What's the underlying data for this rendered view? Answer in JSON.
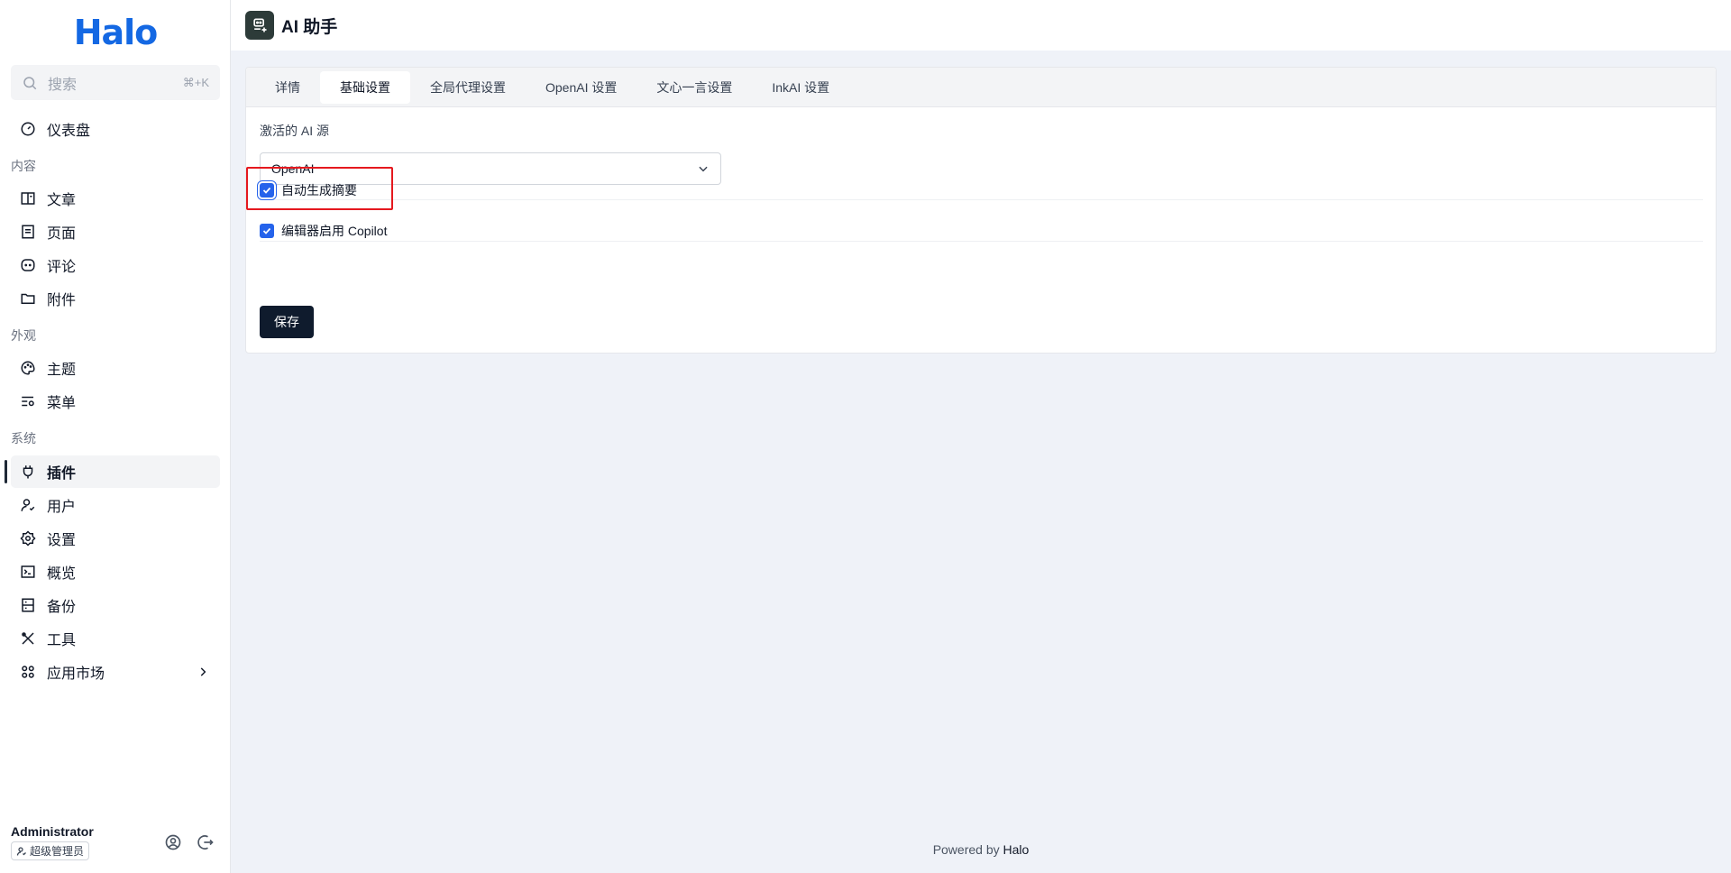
{
  "sidebar": {
    "logo": "Halo",
    "search": {
      "placeholder": "搜索",
      "shortcut": "⌘+K"
    },
    "items": {
      "dashboard": "仪表盘",
      "group_content": "内容",
      "posts": "文章",
      "pages": "页面",
      "comments": "评论",
      "attachments": "附件",
      "group_appearance": "外观",
      "themes": "主题",
      "menus": "菜单",
      "group_system": "系统",
      "plugins": "插件",
      "users": "用户",
      "settings": "设置",
      "overview": "概览",
      "backup": "备份",
      "tools": "工具",
      "app_market": "应用市场"
    },
    "active_item": "插件",
    "user": {
      "name": "Administrator",
      "role": "超级管理员"
    }
  },
  "header": {
    "title": "AI 助手"
  },
  "tabs": [
    "详情",
    "基础设置",
    "全局代理设置",
    "OpenAI 设置",
    "文心一言设置",
    "InkAI 设置"
  ],
  "active_tab": "基础设置",
  "form": {
    "source_label": "激活的 AI 源",
    "source_value": "OpenAI",
    "auto_summary_label": "自动生成摘要",
    "auto_summary_checked": true,
    "copilot_label": "编辑器启用 Copilot",
    "copilot_checked": true,
    "save_label": "保存"
  },
  "footer": {
    "prefix": "Powered by ",
    "brand": "Halo"
  },
  "colors": {
    "brand": "#1468e3",
    "primary_button": "#0f1b2d",
    "checkbox": "#2563eb",
    "highlight": "#e5191f"
  }
}
